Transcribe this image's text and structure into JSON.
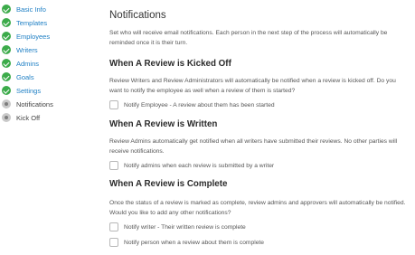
{
  "sidebar": {
    "steps": [
      {
        "label": "Basic Info",
        "state": "done"
      },
      {
        "label": "Templates",
        "state": "done"
      },
      {
        "label": "Employees",
        "state": "done"
      },
      {
        "label": "Writers",
        "state": "done"
      },
      {
        "label": "Admins",
        "state": "done"
      },
      {
        "label": "Goals",
        "state": "done"
      },
      {
        "label": "Settings",
        "state": "done"
      },
      {
        "label": "Notifications",
        "state": "current"
      },
      {
        "label": "Kick Off",
        "state": "pending"
      }
    ],
    "icons": {
      "done": "check-circle-icon",
      "pending": "radio-dot-icon"
    },
    "colors": {
      "done": "#3cab4a",
      "link": "#1e7fc4"
    }
  },
  "main": {
    "title": "Notifications",
    "intro": "Set who will receive email notifications. Each person in the next step of the process will automatically be reminded once it is their turn.",
    "sections": [
      {
        "heading": "When A Review is Kicked Off",
        "description": "Review Writers and Review Administrators will automatically be notified when a review is kicked off. Do you want to notify the employee as well when a review of them is started?",
        "options": [
          {
            "label": "Notify Employee - A review about them has been started",
            "checked": false
          }
        ]
      },
      {
        "heading": "When A Review is Written",
        "description": "Review Admins automatically get notified when all writers have submitted their reviews. No other parties will receive notifications.",
        "options": [
          {
            "label": "Notify admins when each review is submitted by a writer",
            "checked": false
          }
        ]
      },
      {
        "heading": "When A Review is Complete",
        "description": "Once the status of a review is marked as complete, review admins and approvers will automatically be notified. Would you like to add any other notifications?",
        "options": [
          {
            "label": "Notify writer - Their written review is complete",
            "checked": false
          },
          {
            "label": "Notify person when a review about them is complete",
            "checked": false
          }
        ]
      }
    ]
  }
}
